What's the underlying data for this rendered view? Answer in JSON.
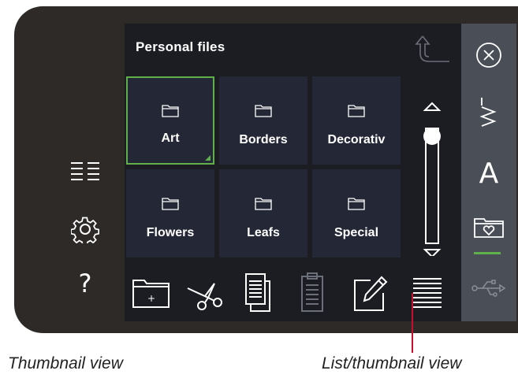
{
  "screen": {
    "title": "Personal files"
  },
  "folders": [
    {
      "label": "Art",
      "selected": true
    },
    {
      "label": "Borders",
      "selected": false
    },
    {
      "label": "Decorativ",
      "selected": false
    },
    {
      "label": "Flowers",
      "selected": false
    },
    {
      "label": "Leafs",
      "selected": false
    },
    {
      "label": "Special",
      "selected": false
    }
  ],
  "left_icons": [
    "list-icon",
    "settings-gear-icon",
    "help-icon"
  ],
  "help_label": "?",
  "toolbar": [
    "new-folder-icon",
    "cut-icon",
    "copy-icon",
    "paste-icon",
    "rename-icon",
    "list-thumbnail-view-icon"
  ],
  "new_folder_symbol": "+",
  "rightbar": [
    "close-icon",
    "stitch-menu-icon",
    "font-icon",
    "file-manager-icon",
    "usb-icon"
  ],
  "font_icon_label": "A",
  "captions": {
    "left": "Thumbnail view",
    "right": "List/thumbnail view"
  },
  "colors": {
    "accent_green": "#5fb04a",
    "callout_red": "#c8102e",
    "tile_bg": "#242836",
    "screen_bg": "#1c1d23",
    "sidebar_bg": "#4a4e57"
  }
}
